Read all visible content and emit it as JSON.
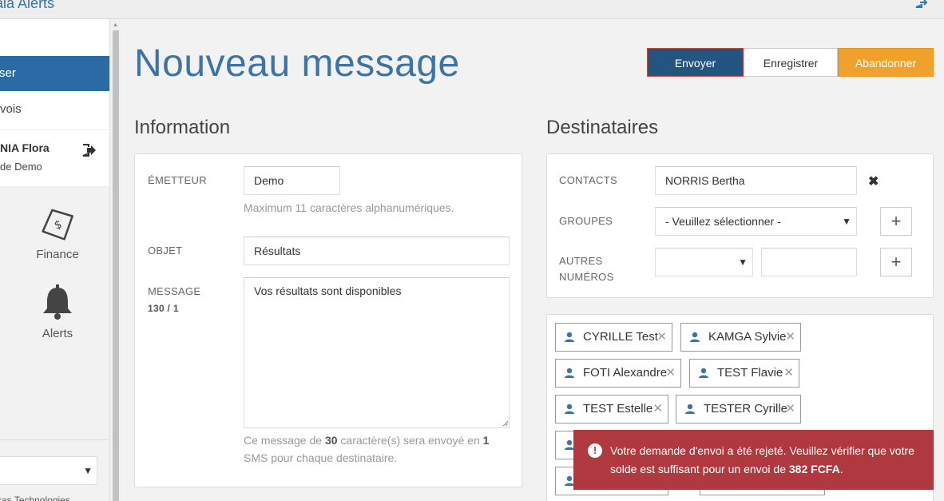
{
  "topbar": {
    "crumb_prefix": "aia",
    "crumb_current": "Alerts"
  },
  "sidebar": {
    "active_item": "ser",
    "second_item": "vois",
    "user_name": "NIA Flora",
    "user_org": "de Demo",
    "nav": [
      {
        "label": "Finance",
        "icon": "money-icon"
      },
      {
        "label": "Alerts",
        "icon": "bell-icon"
      }
    ],
    "company": "rcas Technologies"
  },
  "page": {
    "title": "Nouveau message",
    "buttons": {
      "send": "Envoyer",
      "save": "Enregistrer",
      "cancel": "Abandonner"
    }
  },
  "information": {
    "heading": "Information",
    "sender_label": "ÉMETTEUR",
    "sender_value": "Demo",
    "sender_help": "Maximum 11 caractères alphanumériques.",
    "subject_label": "OBJET",
    "subject_value": "Résultats",
    "message_label": "MESSAGE",
    "message_counter": "130 / 1",
    "message_value": "Vos résultats sont disponibles",
    "summary_prefix": "Ce message de ",
    "summary_chars": "30",
    "summary_mid": " caractère(s) sera envoyé en ",
    "summary_sms": "1",
    "summary_suffix": " SMS pour chaque destinataire."
  },
  "recipients": {
    "heading": "Destinataires",
    "contacts_label": "CONTACTS",
    "contacts_value": "NORRIS Bertha",
    "groups_label": "GROUPES",
    "groups_value": "- Veuillez sélectionner -",
    "other_label_line1": "AUTRES",
    "other_label_line2": "NUMÉROS",
    "chips": [
      {
        "name": "CYRILLE Test"
      },
      {
        "name": "KAMGA Sylvie"
      },
      {
        "name": "FOTI Alexandre"
      },
      {
        "name": "TEST Flavie"
      },
      {
        "name": "TEST Estelle"
      },
      {
        "name": "TESTER Cyrille"
      }
    ]
  },
  "toast": {
    "text_prefix": "Votre demande d'envoi a été rejeté. Veuillez vérifier que votre solde est suffisant pour un envoi de ",
    "amount": "382 FCFA",
    "text_suffix": ".",
    "color": "#b0393f"
  },
  "colors": {
    "accent": "#3a74a8",
    "primary_button": "#245480",
    "cancel_button": "#f0a02c",
    "sidebar_active": "#2c6aa5"
  }
}
